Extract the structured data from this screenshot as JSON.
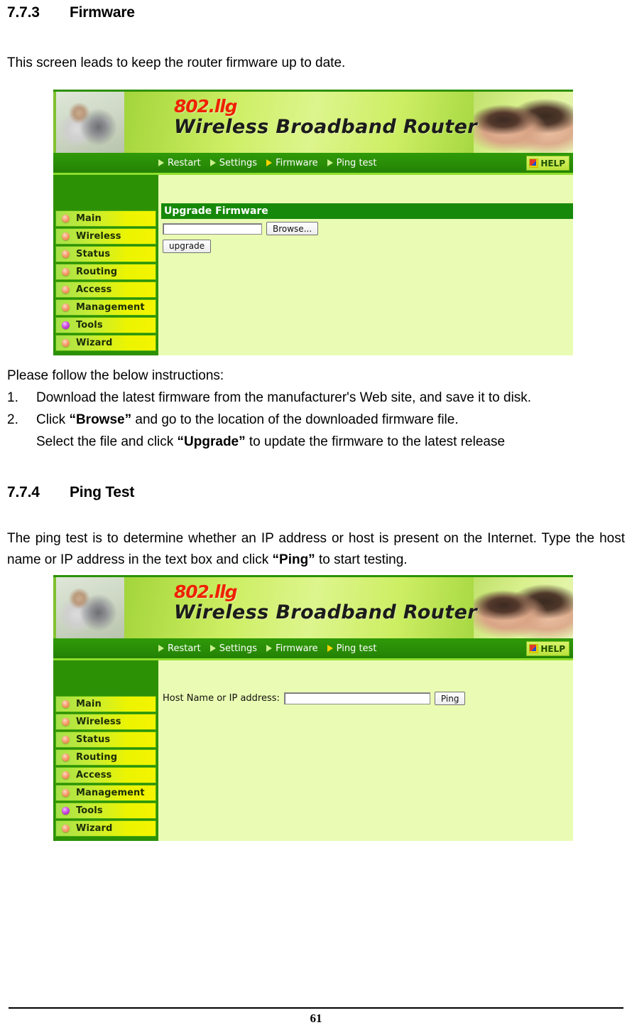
{
  "sections": [
    {
      "number": "7.7.3",
      "title": "Firmware",
      "intro": "This screen leads to keep the router firmware up to date."
    },
    {
      "number": "7.7.4",
      "title": "Ping Test",
      "intro_part1": "The ping test is to determine whether an IP address or host is present on the Internet. Type the host name or IP address in the text box and click ",
      "intro_bold": "“Ping”",
      "intro_part2": " to start testing."
    }
  ],
  "instructions": {
    "lead": "Please follow the below instructions:",
    "items": [
      {
        "marker": "1.",
        "text": "Download the latest firmware from the manufacturer's Web site, and save it to disk."
      },
      {
        "marker": "2.",
        "line1_a": "Click ",
        "line1_bold": "“Browse”",
        "line1_b": " and go to the location of the downloaded firmware file.",
        "line2_a": "Select the file and click ",
        "line2_bold": "“Upgrade”",
        "line2_b": " to update the firmware to the latest release"
      }
    ]
  },
  "router_ui": {
    "banner": {
      "standard": "802.llg",
      "product": "Wireless  Broadband  Router",
      "help_label": "HELP"
    },
    "nav": [
      {
        "label": "Restart",
        "active_firmware": false,
        "active_ping": false
      },
      {
        "label": "Settings",
        "active_firmware": false,
        "active_ping": false
      },
      {
        "label": "Firmware",
        "active_firmware": true,
        "active_ping": false
      },
      {
        "label": "Ping test",
        "active_firmware": false,
        "active_ping": true
      }
    ],
    "sidebar": [
      {
        "label": "Main",
        "active": false
      },
      {
        "label": "Wireless",
        "active": false
      },
      {
        "label": "Status",
        "active": false
      },
      {
        "label": "Routing",
        "active": false
      },
      {
        "label": "Access",
        "active": false
      },
      {
        "label": "Management",
        "active": false
      },
      {
        "label": "Tools",
        "active": true
      },
      {
        "label": "Wizard",
        "active": false
      }
    ],
    "firmware_screen": {
      "section_title": "Upgrade Firmware",
      "file_input_value": "",
      "browse_label": "Browse...",
      "upgrade_label": "upgrade"
    },
    "ping_screen": {
      "host_label": "Host Name or IP address:",
      "host_input_value": "",
      "ping_label": "Ping"
    }
  },
  "colors": {
    "sidebar_bg": "#2d9106",
    "content_bg": "#eafcb3",
    "section_bar": "#16890a",
    "nav_bar": "#2a8d07",
    "accent_red": "#ee2200",
    "active_bullet": "#9b12b8",
    "inactive_bullet": "#e2743c"
  },
  "footer": {
    "page_number": "61"
  }
}
